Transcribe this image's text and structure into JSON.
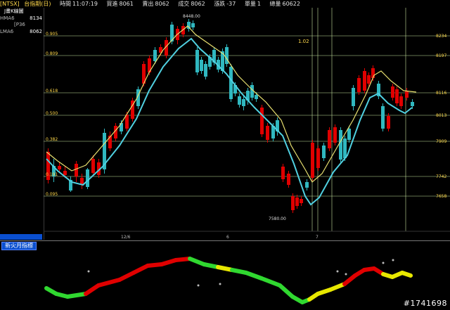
{
  "topbar": {
    "code": "[NTSX]",
    "name": "台指期(日)",
    "label_time": "時間",
    "time": "11:07:19",
    "label_buy": "買進",
    "buy": "8061",
    "label_sell": "賣出",
    "sell": "8062",
    "label_deal": "成交",
    "deal": "8062",
    "label_change": "漲跌",
    "change": "-37",
    "label_vol": "單量",
    "vol": "1",
    "label_total": "總量",
    "total": "60622"
  },
  "left_panel": {
    "title": "J畫K線圖",
    "row1_label": "HMA6",
    "row1_value": "8134",
    "row2_label": "LMA6",
    "row2_value": "8062",
    "row_mid": "[P36"
  },
  "chart": {
    "fib_levels": [
      {
        "label": "0.905",
        "value": "8234"
      },
      {
        "label": "0.809",
        "value": "8197"
      },
      {
        "label": "0.618",
        "value": "8116"
      },
      {
        "label": "0.500",
        "value": "8013"
      },
      {
        "label": "0.382",
        "value": "7909"
      },
      {
        "label": "0.191",
        "value": "7742"
      },
      {
        "label": "0.095",
        "value": "7658"
      }
    ],
    "high_label": "8448.00",
    "low_label": "7580.00",
    "x_labels": [
      "12/6",
      "6",
      "7"
    ],
    "annotation": "1.02"
  },
  "indicator": {
    "title": "新火月指標"
  },
  "colors": {
    "up": "#e00000",
    "down": "#30b8c0",
    "ma_yellow": "#e8e070",
    "ma_cyan": "#50d0e0",
    "grid": "#c8e6a0"
  },
  "watermark": "#1741698"
}
